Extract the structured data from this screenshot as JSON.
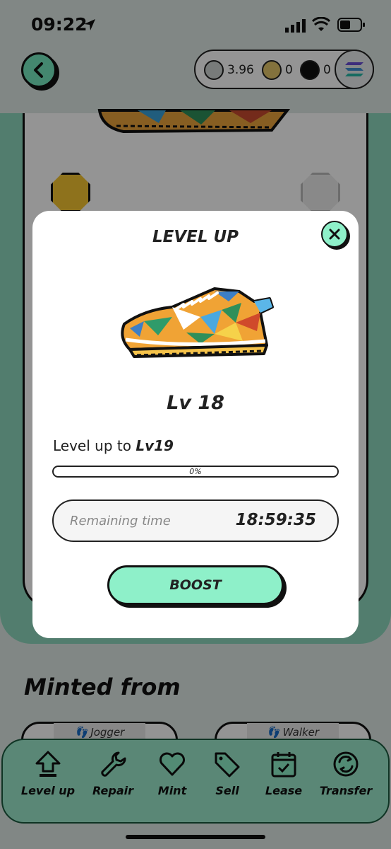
{
  "status_bar": {
    "time": "09:22"
  },
  "header": {
    "balances": [
      {
        "icon": "gst-coin-icon",
        "value": "3.96"
      },
      {
        "icon": "gmt-coin-icon",
        "value": "0"
      },
      {
        "icon": "sol-coin-icon",
        "value": "0"
      }
    ]
  },
  "modal": {
    "title": "LEVEL UP",
    "level": "Lv 18",
    "levelup_prefix": "Level up to",
    "levelup_target": "Lv19",
    "progress_text": "0%",
    "progress_fraction": 0,
    "remaining_label": "Remaining time",
    "remaining_time": "18:59:35",
    "boost_label": "BOOST"
  },
  "minted": {
    "title": "Minted from",
    "parents": [
      {
        "label": "Jogger"
      },
      {
        "label": "Walker"
      }
    ]
  },
  "bottom_nav": [
    {
      "label": "Level up",
      "icon": "level-up-icon"
    },
    {
      "label": "Repair",
      "icon": "wrench-icon"
    },
    {
      "label": "Mint",
      "icon": "heart-icon"
    },
    {
      "label": "Sell",
      "icon": "tag-icon"
    },
    {
      "label": "Lease",
      "icon": "calendar-icon"
    },
    {
      "label": "Transfer",
      "icon": "transfer-icon"
    }
  ],
  "colors": {
    "accent": "#8ef0c9",
    "card_bg": "#8ed8bd",
    "lock": "#f4c431"
  }
}
